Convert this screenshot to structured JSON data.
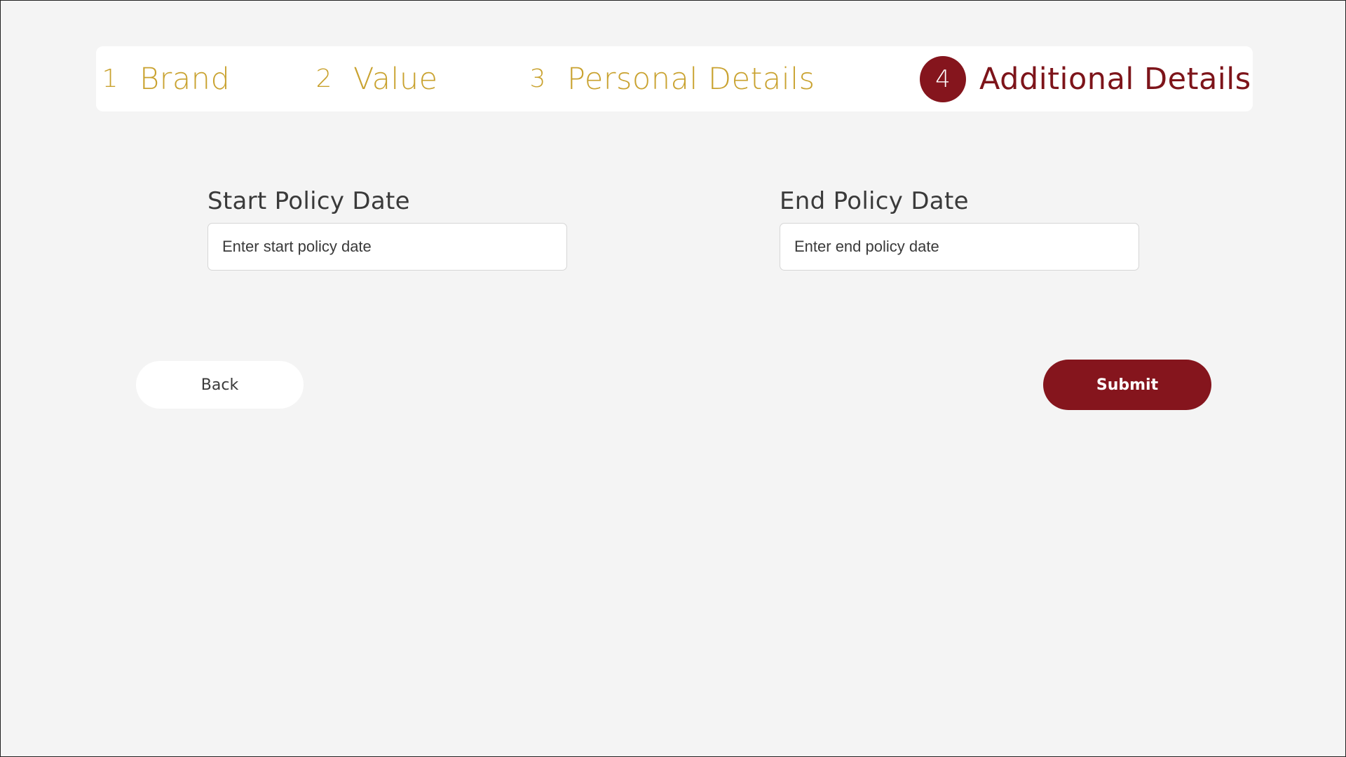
{
  "stepper": {
    "steps": [
      {
        "number": "1",
        "label": "Brand",
        "state": "inactive"
      },
      {
        "number": "2",
        "label": "Value",
        "state": "inactive"
      },
      {
        "number": "3",
        "label": "Personal Details",
        "state": "inactive"
      },
      {
        "number": "4",
        "label": "Additional Details",
        "state": "active"
      }
    ]
  },
  "form": {
    "start_date": {
      "label": "Start Policy Date",
      "value": "",
      "placeholder": "Enter start policy date"
    },
    "end_date": {
      "label": "End Policy Date",
      "value": "",
      "placeholder": "Enter end policy date"
    }
  },
  "actions": {
    "back_label": "Back",
    "submit_label": "Submit"
  },
  "colors": {
    "accent": "#85151d",
    "inactive_step": "#c9a22f",
    "background": "#f4f4f4"
  }
}
